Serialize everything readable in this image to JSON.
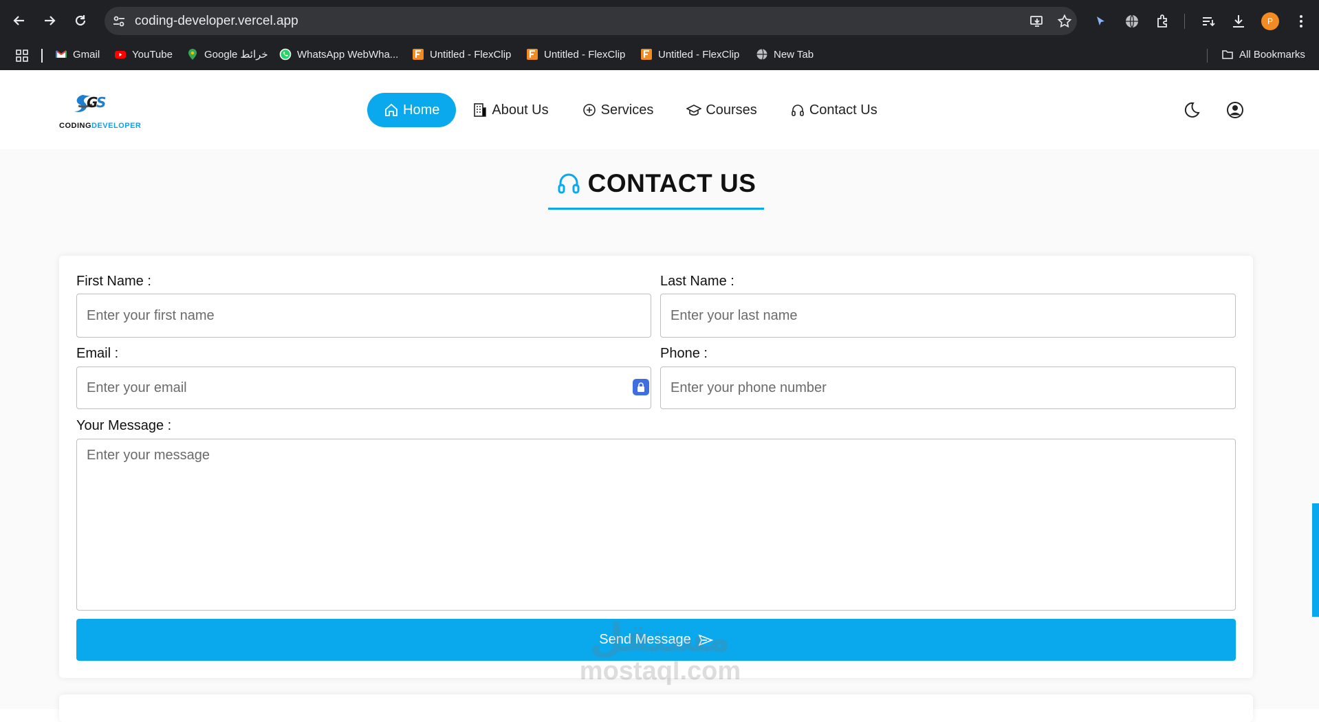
{
  "browser": {
    "url": "coding-developer.vercel.app",
    "profile_initial": "P",
    "bookmarks": [
      {
        "label": "Gmail",
        "icon": "gmail-icon"
      },
      {
        "label": "YouTube",
        "icon": "youtube-icon"
      },
      {
        "label": "Google خرائط",
        "icon": "google-maps-icon"
      },
      {
        "label": "WhatsApp WebWha...",
        "icon": "whatsapp-icon"
      },
      {
        "label": "Untitled - FlexClip",
        "icon": "flexclip-icon"
      },
      {
        "label": "Untitled - FlexClip",
        "icon": "flexclip-icon"
      },
      {
        "label": "Untitled - FlexClip",
        "icon": "flexclip-icon"
      },
      {
        "label": "New Tab",
        "icon": "globe-icon"
      }
    ],
    "all_bookmarks_label": "All Bookmarks"
  },
  "site": {
    "logo": {
      "line1": "CODING",
      "line2": "DEVELOPER"
    },
    "nav": [
      {
        "label": "Home",
        "icon": "home-icon",
        "active": true
      },
      {
        "label": "About Us",
        "icon": "building-icon",
        "active": false
      },
      {
        "label": "Services",
        "icon": "plus-circle-icon",
        "active": false
      },
      {
        "label": "Courses",
        "icon": "graduation-cap-icon",
        "active": false
      },
      {
        "label": "Contact Us",
        "icon": "headset-icon",
        "active": false
      }
    ]
  },
  "page": {
    "title": "CONTACT US",
    "form": {
      "first_name_label": "First Name :",
      "first_name_placeholder": "Enter your first name",
      "last_name_label": "Last Name :",
      "last_name_placeholder": "Enter your last name",
      "email_label": "Email :",
      "email_placeholder": "Enter your email",
      "phone_label": "Phone :",
      "phone_placeholder": "Enter your phone number",
      "message_label": "Your Message :",
      "message_placeholder": "Enter your message",
      "submit_label": "Send Message"
    }
  },
  "watermark": {
    "arabic": "مستقل",
    "english": "mostaql.com"
  },
  "colors": {
    "accent": "#0aa8ed",
    "chrome_bg": "#202124",
    "omnibox_bg": "#35363a"
  }
}
